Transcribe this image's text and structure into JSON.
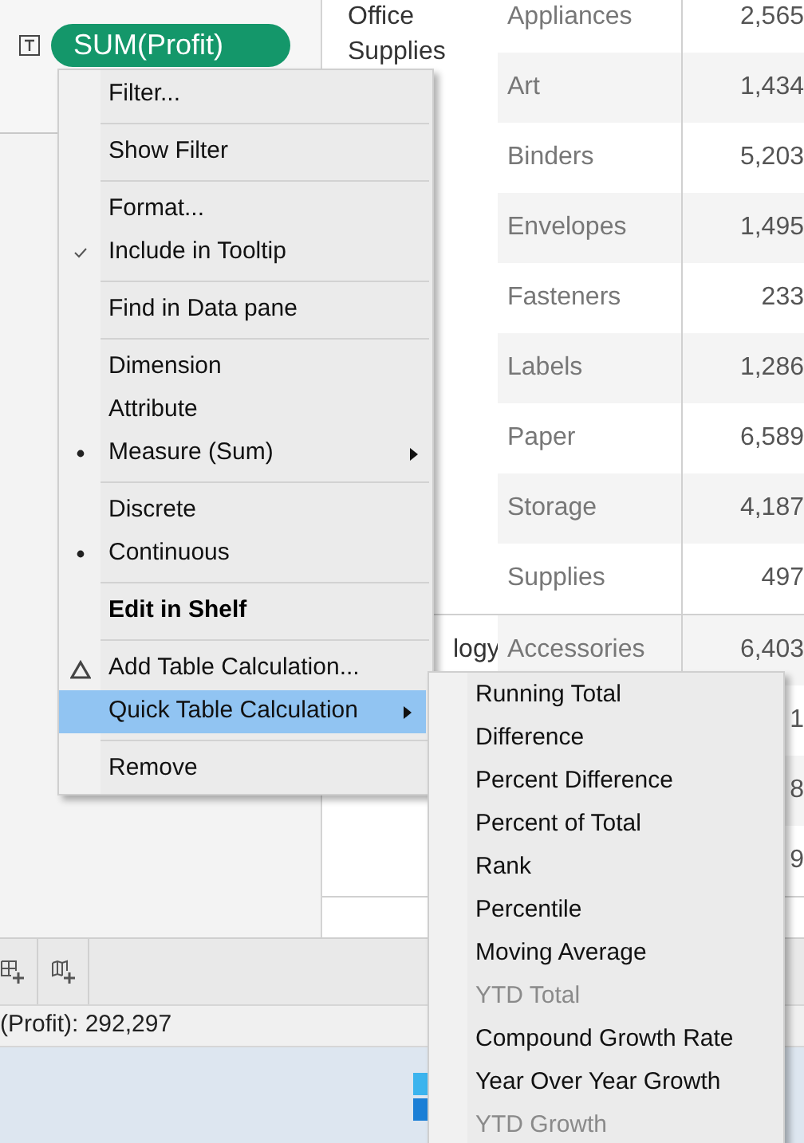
{
  "shelf": {
    "pill": "SUM(Profit)"
  },
  "table": {
    "segments": [
      {
        "label": "Office Supplies",
        "rows": [
          {
            "category": "Appliances",
            "value": "2,565"
          },
          {
            "category": "Art",
            "value": "1,434"
          },
          {
            "category": "Binders",
            "value": "5,203"
          },
          {
            "category": "Envelopes",
            "value": "1,495"
          },
          {
            "category": "Fasteners",
            "value": "233"
          },
          {
            "category": "Labels",
            "value": "1,286"
          },
          {
            "category": "Paper",
            "value": "6,589"
          },
          {
            "category": "Storage",
            "value": "4,187"
          },
          {
            "category": "Supplies",
            "value": "497"
          }
        ]
      },
      {
        "label": "logy",
        "rows": [
          {
            "category": "Accessories",
            "value": "6,403"
          },
          {
            "value": "1"
          },
          {
            "value": "8"
          },
          {
            "value": "9"
          }
        ]
      }
    ]
  },
  "status_bar": {
    "text": "(Profit): 292,297"
  },
  "context_menu": {
    "groups": [
      [
        {
          "label": "Filter...",
          "highlighted": false,
          "submenu": false
        }
      ],
      [
        {
          "label": "Show Filter",
          "highlighted": false,
          "submenu": false
        }
      ],
      [
        {
          "label": "Format...",
          "highlighted": false,
          "submenu": false
        },
        {
          "label": "Include in Tooltip",
          "highlighted": false,
          "submenu": false,
          "kind": "check"
        }
      ],
      [
        {
          "label": "Find in Data pane",
          "highlighted": false,
          "submenu": false
        }
      ],
      [
        {
          "label": "Dimension",
          "highlighted": false,
          "submenu": false
        },
        {
          "label": "Attribute",
          "highlighted": false,
          "submenu": false
        },
        {
          "label": "Measure (Sum)",
          "highlighted": false,
          "submenu": true,
          "kind": "radio"
        }
      ],
      [
        {
          "label": "Discrete",
          "highlighted": false,
          "submenu": false
        },
        {
          "label": "Continuous",
          "highlighted": false,
          "submenu": false,
          "kind": "radio"
        }
      ],
      [
        {
          "label": "Edit in Shelf",
          "highlighted": false,
          "submenu": false,
          "bold": true
        }
      ],
      [
        {
          "label": "Add Table Calculation...",
          "highlighted": false,
          "submenu": false,
          "kind": "calc"
        },
        {
          "label": "Quick Table Calculation",
          "highlighted": true,
          "submenu": true
        }
      ],
      [
        {
          "label": "Remove",
          "highlighted": false,
          "submenu": false
        }
      ]
    ]
  },
  "submenu": {
    "items": [
      {
        "label": "Running Total",
        "disabled": false
      },
      {
        "label": "Difference",
        "disabled": false
      },
      {
        "label": "Percent Difference",
        "disabled": false
      },
      {
        "label": "Percent of Total",
        "disabled": false
      },
      {
        "label": "Rank",
        "disabled": false
      },
      {
        "label": "Percentile",
        "disabled": false
      },
      {
        "label": "Moving Average",
        "disabled": false
      },
      {
        "label": "YTD Total",
        "disabled": true
      },
      {
        "label": "Compound Growth Rate",
        "disabled": false
      },
      {
        "label": "Year Over Year Growth",
        "disabled": false
      },
      {
        "label": "YTD Growth",
        "disabled": true
      }
    ]
  }
}
